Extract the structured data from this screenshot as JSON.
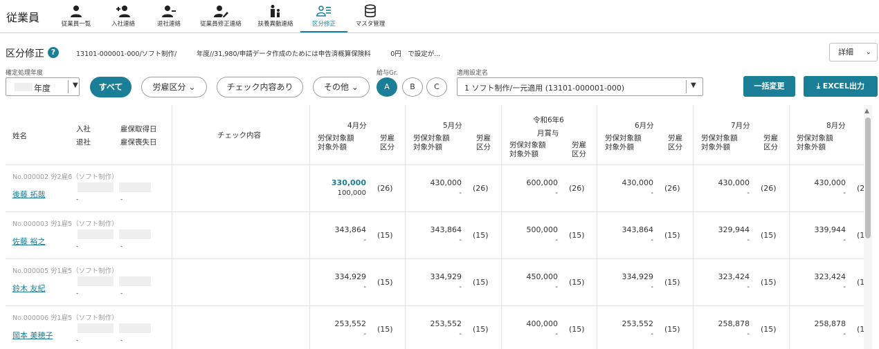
{
  "app_title": "従業員",
  "nav": [
    {
      "label": "従業員一覧",
      "icon": "person-icon"
    },
    {
      "label": "入社連絡",
      "icon": "person-add-icon"
    },
    {
      "label": "退社連絡",
      "icon": "person-remove-icon"
    },
    {
      "label": "従業員修正連絡",
      "icon": "person-edit-icon"
    },
    {
      "label": "扶養異動連絡",
      "icon": "family-icon"
    },
    {
      "label": "区分修正",
      "icon": "person-list-icon"
    },
    {
      "label": "マスタ管理",
      "icon": "database-icon"
    }
  ],
  "active_nav": "区分修正",
  "header": {
    "title": "区分修正",
    "description": "13101-000001-000/ソフト制作/　　　年度//31,980/申請データ作成のためには申告済概算保険料　　　0円　で設定が...",
    "detail_label": "詳細"
  },
  "filters": {
    "year_label": "確定処理年度",
    "year_value": "年度",
    "all_label": "すべて",
    "employment_label": "労雇区分",
    "check_label": "チェック内容あり",
    "other_label": "その他",
    "grade_label": "給与Gr.",
    "grades": [
      "A",
      "B",
      "C"
    ],
    "setting_label": "適用設定名",
    "setting_value": "1 ソフト制作/一元適用 (13101-000001-000)",
    "bulk_label": "一括変更",
    "excel_label": "EXCEL出力"
  },
  "table": {
    "headers": {
      "name": "姓名",
      "join": "入社",
      "leave": "退社",
      "ins_get": "雇保取得日",
      "ins_lost": "雇保喪失日",
      "check": "チェック内容",
      "amount_top": "労保対象額",
      "amount_bottom": "対象外額",
      "kubun_top": "労雇",
      "kubun_bottom": "区分",
      "bonus_sub": "月賞与"
    },
    "months": [
      "4月分",
      "5月分",
      "令和6年6",
      "6月分",
      "7月分",
      "8月分"
    ],
    "rows": [
      {
        "meta": "No.000002 労2雇6（ソフト制作）",
        "name": "後藤 拓哉",
        "cells": [
          [
            "330,000",
            "100,000",
            "(26)"
          ],
          [
            "430,000",
            "-",
            "(26)"
          ],
          [
            "600,000",
            "-",
            "(26)"
          ],
          [
            "430,000",
            "-",
            "(26)"
          ],
          [
            "430,000",
            "-",
            "(26)"
          ],
          [
            "430,000",
            "-",
            "(2"
          ]
        ]
      },
      {
        "meta": "No.000003 労1雇5（ソフト制作）",
        "name": "佐藤 裕之",
        "cells": [
          [
            "343,864",
            "-",
            "(15)"
          ],
          [
            "343,864",
            "-",
            "(15)"
          ],
          [
            "500,000",
            "-",
            "(15)"
          ],
          [
            "343,864",
            "-",
            "(15)"
          ],
          [
            "329,944",
            "-",
            "(15)"
          ],
          [
            "339,944",
            "-",
            "(1"
          ]
        ]
      },
      {
        "meta": "No.000005 労1雇5（ソフト制作）",
        "name": "鈴木 友紀",
        "cells": [
          [
            "334,929",
            "-",
            "(15)"
          ],
          [
            "334,929",
            "-",
            "(15)"
          ],
          [
            "450,000",
            "-",
            "(15)"
          ],
          [
            "334,929",
            "-",
            "(15)"
          ],
          [
            "323,424",
            "-",
            "(15)"
          ],
          [
            "323,424",
            "-",
            "(1"
          ]
        ]
      },
      {
        "meta": "No.000006 労1雇5（ソフト制作）",
        "name": "岡本 美穂子",
        "cells": [
          [
            "253,552",
            "-",
            "(15)"
          ],
          [
            "253,552",
            "-",
            "(15)"
          ],
          [
            "400,000",
            "-",
            "(15)"
          ],
          [
            "253,552",
            "-",
            "(15)"
          ],
          [
            "258,878",
            "-",
            "(15)"
          ],
          [
            "258,878",
            "-",
            "(1"
          ]
        ]
      }
    ],
    "dash": "-"
  },
  "colors": {
    "accent": "#1a7f96"
  }
}
